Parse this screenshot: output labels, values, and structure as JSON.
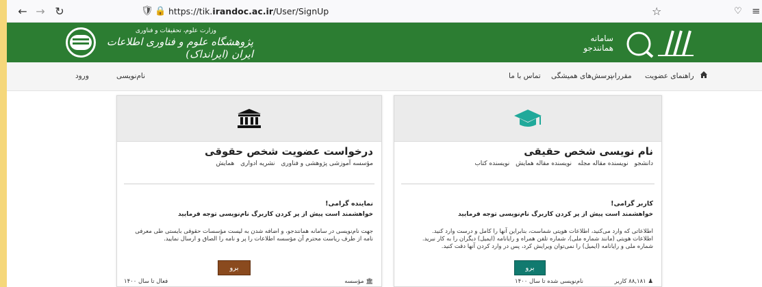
{
  "browser": {
    "url_prefix": "https://tik.",
    "url_domain": "irandoc.ac.ir",
    "url_path": "/User/SignUp"
  },
  "banner": {
    "ministry": "وزارت علوم، تحقیقات و فناوری",
    "institute": "پژوهشگاه علوم و فناوری اطلاعات ایران (ایرانداک)",
    "system_line1": "سامانه",
    "system_line2": "همانندجو"
  },
  "nav": {
    "guide": "راهنمای عضویت",
    "rules": "مقررات",
    "faq": "پرسش‌های همیشگی",
    "contact": "تماس با ما",
    "register": "نام‌نویسی",
    "login": "ورود"
  },
  "card_real": {
    "title": "نام نویسی شخص حقیقی",
    "tags": [
      "دانشجو",
      "نویسنده مقاله مجله",
      "نویسنده مقاله همایش",
      "نویسنده کتاب"
    ],
    "greeting": "کاربر گرامی!",
    "request": "خواهشمند است پیش از پر کردن کاربرگ نام‌نویسی توجه فرمایید",
    "line1": "اطلاعاتی که وارد می‌کنید، اطلاعات هویتی شماست، بنابراین آنها را کامل و درست وارد کنید.",
    "line2": "اطلاعات هویتی (مانند شماره ملی)، شماره تلفن همراه و رایانامه (ایمیل) دیگران را به کار نبرید.",
    "line3": "شماره ملی و رایانامه (ایمیل) را نمی‌توان ویرایش کرد، پس در وارد کردن آنها دقت کنید.",
    "button": "برو",
    "user_count": "۸۸,۱۸۱",
    "user_label": "کاربر",
    "registered_note": "نام‌نویسی شده تا سال ۱۴۰۰"
  },
  "card_legal": {
    "title": "درخواست عضویت شخص حقوقی",
    "tags": [
      "مؤسسه آموزشی پژوهشی و فناوری",
      "نشریه ادواری",
      "همایش"
    ],
    "greeting": "نماینده گرامی!",
    "request": "خواهشمند است پیش از پر کردن کاربرگ نام‌نویسی توجه فرمایید",
    "line1": "جهت نام‌نویسی در سامانه همانندجو، و اضافه شدن به لیست مؤسسات حقوقی بایستی طی معرفی",
    "line2": "نامه از طرف ریاست محترم آن مؤسسه اطلاعات را پر و نامه را الصاق و ارسال نمایید.",
    "button": "برو",
    "org_label": "مؤسسه",
    "active_note": "فعال تا سال ۱۴۰۰"
  },
  "colors": {
    "banner": "#2c7d32",
    "go_real": "#117a6f",
    "go_legal": "#8a4a1e",
    "grad_cap": "#20a99a"
  }
}
